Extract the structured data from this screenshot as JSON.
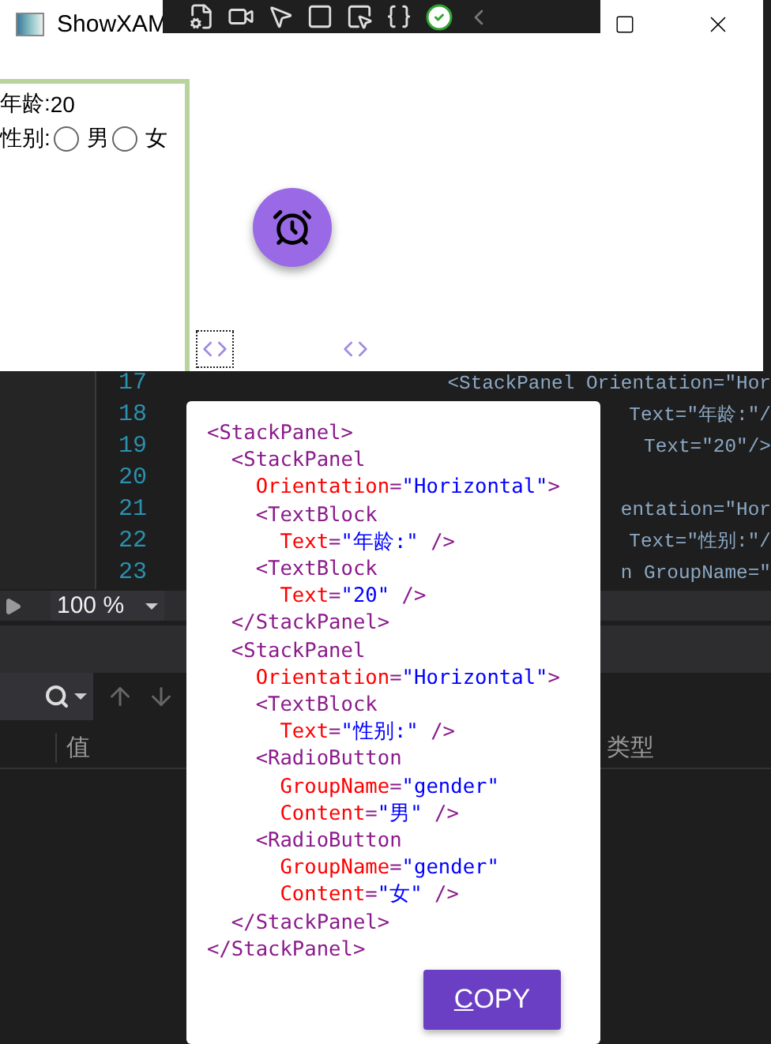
{
  "window": {
    "title": "ShowXAM"
  },
  "preview": {
    "age_label": "年龄:",
    "age_value": "20",
    "gender_label": "性别:",
    "options": [
      {
        "label": "男",
        "selected": false
      },
      {
        "label": "女",
        "selected": false
      }
    ]
  },
  "editor": {
    "lines": [
      {
        "number": "17",
        "code": "<StackPanel Orientation=\"Hor"
      },
      {
        "number": "18",
        "code": "Text=\"年龄:\"/"
      },
      {
        "number": "19",
        "code": "Text=\"20\"/>"
      },
      {
        "number": "20"
      },
      {
        "number": "21",
        "code": "entation=\"Hor"
      },
      {
        "number": "22",
        "code": "Text=\"性别:\"/"
      },
      {
        "number": "23",
        "code": "n GroupName=\""
      }
    ],
    "zoom": "100 %"
  },
  "popup": {
    "code_lines": [
      [
        {
          "kind": "tag",
          "text": "<StackPanel>"
        }
      ],
      [
        {
          "kind": "tag",
          "text": "  <StackPanel"
        }
      ],
      [
        {
          "kind": "attr",
          "text": "    Orientation"
        },
        {
          "kind": "punct",
          "text": "="
        },
        {
          "kind": "value",
          "text": "\"Horizontal\""
        },
        {
          "kind": "tag",
          "text": ">"
        }
      ],
      [
        {
          "kind": "tag",
          "text": "    <TextBlock"
        }
      ],
      [
        {
          "kind": "attr",
          "text": "      Text"
        },
        {
          "kind": "punct",
          "text": "="
        },
        {
          "kind": "value",
          "text": "\"年龄:\""
        },
        {
          "kind": "tag",
          "text": " />"
        }
      ],
      [
        {
          "kind": "tag",
          "text": "    <TextBlock"
        }
      ],
      [
        {
          "kind": "attr",
          "text": "      Text"
        },
        {
          "kind": "punct",
          "text": "="
        },
        {
          "kind": "value",
          "text": "\"20\""
        },
        {
          "kind": "tag",
          "text": " />"
        }
      ],
      [
        {
          "kind": "tag",
          "text": "  </StackPanel>"
        }
      ],
      [
        {
          "kind": "tag",
          "text": "  <StackPanel"
        }
      ],
      [
        {
          "kind": "attr",
          "text": "    Orientation"
        },
        {
          "kind": "punct",
          "text": "="
        },
        {
          "kind": "value",
          "text": "\"Horizontal\""
        },
        {
          "kind": "tag",
          "text": ">"
        }
      ],
      [
        {
          "kind": "tag",
          "text": "    <TextBlock"
        }
      ],
      [
        {
          "kind": "attr",
          "text": "      Text"
        },
        {
          "kind": "punct",
          "text": "="
        },
        {
          "kind": "value",
          "text": "\"性别:\""
        },
        {
          "kind": "tag",
          "text": " />"
        }
      ],
      [
        {
          "kind": "tag",
          "text": "    <RadioButton"
        }
      ],
      [
        {
          "kind": "attr",
          "text": "      GroupName"
        },
        {
          "kind": "punct",
          "text": "="
        },
        {
          "kind": "value",
          "text": "\"gender\""
        }
      ],
      [
        {
          "kind": "attr",
          "text": "      Content"
        },
        {
          "kind": "punct",
          "text": "="
        },
        {
          "kind": "value",
          "text": "\"男\""
        },
        {
          "kind": "tag",
          "text": " />"
        }
      ],
      [
        {
          "kind": "tag",
          "text": "    <RadioButton"
        }
      ],
      [
        {
          "kind": "attr",
          "text": "      GroupName"
        },
        {
          "kind": "punct",
          "text": "="
        },
        {
          "kind": "value",
          "text": "\"gender\""
        }
      ],
      [
        {
          "kind": "attr",
          "text": "      Content"
        },
        {
          "kind": "punct",
          "text": "="
        },
        {
          "kind": "value",
          "text": "\"女\""
        },
        {
          "kind": "tag",
          "text": " />"
        }
      ],
      [
        {
          "kind": "tag",
          "text": "  </StackPanel>"
        }
      ],
      [
        {
          "kind": "tag",
          "text": "</StackPanel>"
        }
      ]
    ],
    "copy_button": "COPY"
  },
  "panel": {
    "columns": [
      "值",
      "类型"
    ]
  }
}
